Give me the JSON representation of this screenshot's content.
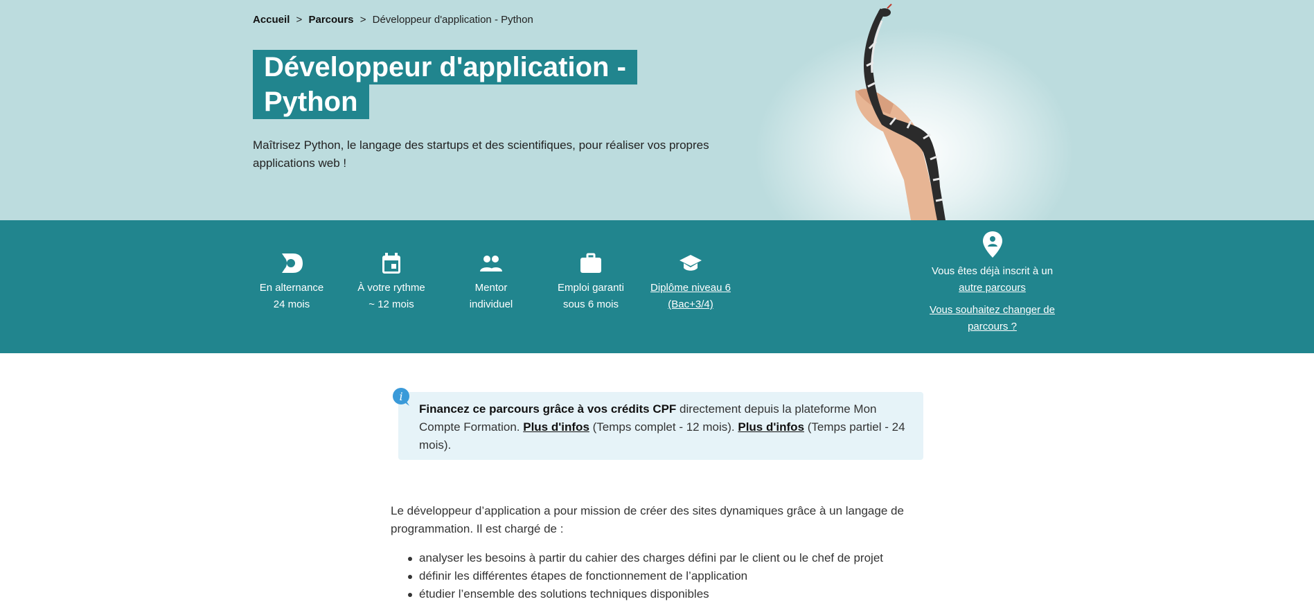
{
  "breadcrumb": {
    "home": "Accueil",
    "sep1": ">",
    "paths": "Parcours",
    "sep2": ">",
    "current": "Développeur d'application - Python"
  },
  "hero": {
    "title_line1": "Développeur d'application -",
    "title_line2": "Python",
    "subtitle": "Maîtrisez Python, le langage des startups et des scientifiques, pour réaliser vos propres applications web !"
  },
  "features": [
    {
      "icon": "alternance-icon",
      "line1": "En alternance",
      "line2": "24 mois"
    },
    {
      "icon": "calendar-icon",
      "line1": "À votre rythme",
      "line2": "~ 12 mois"
    },
    {
      "icon": "people-icon",
      "line1": "Mentor",
      "line2": "individuel"
    },
    {
      "icon": "briefcase-icon",
      "line1": "Emploi garanti",
      "line2": "sous 6 mois"
    },
    {
      "icon": "graduation-cap-icon",
      "line1": "Diplôme niveau 6",
      "line2": "(Bac+3/4)"
    }
  ],
  "registration": {
    "icon": "location-pin-icon",
    "text": "Vous êtes déjà inscrit à un",
    "link1": "autre parcours",
    "link2": "Vous souhaitez changer de parcours ?"
  },
  "cpf": {
    "bold": "Financez ce parcours grâce à vos crédits CPF",
    "text1": " directement depuis la plateforme Mon Compte Formation. ",
    "link1": "Plus d'infos",
    "text2": " (Temps complet - 12 mois). ",
    "link2": "Plus d'infos",
    "text3": " (Temps partiel - 24 mois).",
    "icon": "info-icon"
  },
  "description": {
    "intro": "Le développeur d’application a pour mission de créer des sites dynamiques grâce à un langage de programmation. Il est chargé de :",
    "items": [
      "analyser les besoins à partir du cahier des charges défini par le client ou le chef de projet",
      "définir les différentes étapes de fonctionnement de l’application",
      "étudier l’ensemble des solutions techniques disponibles"
    ]
  },
  "colors": {
    "hero_bg": "#bcdcde",
    "band_bg": "#21858e",
    "title_bg": "#21858e",
    "cpf_bg": "#e6f3f8",
    "info_icon": "#3a9ad9"
  }
}
